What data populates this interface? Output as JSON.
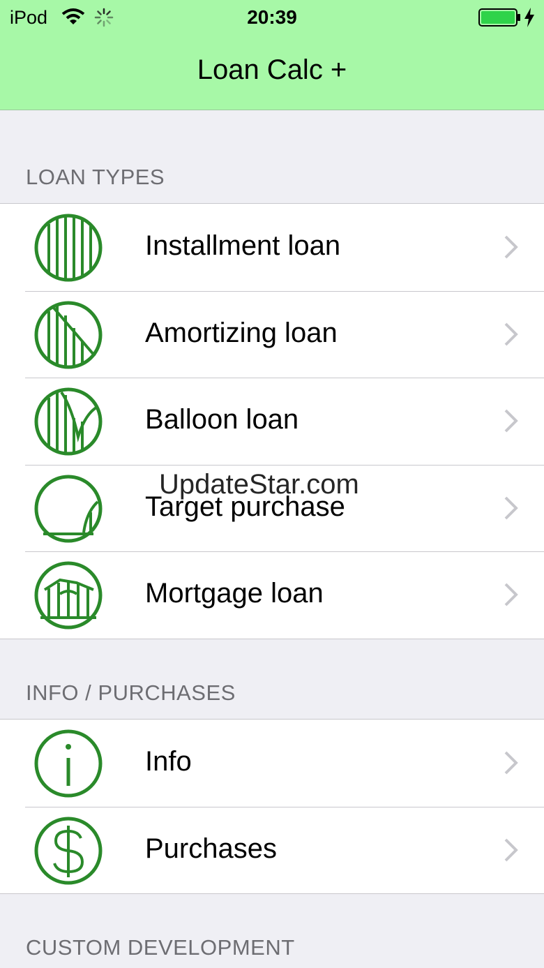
{
  "status_bar": {
    "carrier": "iPod",
    "time": "20:39",
    "wifi_icon": "wifi-icon",
    "activity_icon": "activity-spinner-icon",
    "battery_icon": "battery-icon",
    "charging_icon": "charging-bolt-icon"
  },
  "nav": {
    "title": "Loan Calc +"
  },
  "sections": [
    {
      "header": "LOAN TYPES",
      "items": [
        {
          "label": "Installment loan",
          "icon": "installment-loan-icon"
        },
        {
          "label": "Amortizing loan",
          "icon": "amortizing-loan-icon"
        },
        {
          "label": "Balloon loan",
          "icon": "balloon-loan-icon"
        },
        {
          "label": "Target purchase",
          "icon": "target-purchase-icon"
        },
        {
          "label": "Mortgage loan",
          "icon": "mortgage-loan-icon"
        }
      ]
    },
    {
      "header": "INFO / PURCHASES",
      "items": [
        {
          "label": "Info",
          "icon": "info-icon"
        },
        {
          "label": "Purchases",
          "icon": "dollar-icon"
        }
      ]
    },
    {
      "header": "CUSTOM DEVELOPMENT",
      "items": []
    }
  ],
  "watermark": "UpdateStar.com",
  "colors": {
    "nav_bar": "#a7f8a7",
    "icon_green": "#2a8a2a",
    "background": "#efeff4",
    "chevron": "#c7c7cc"
  }
}
